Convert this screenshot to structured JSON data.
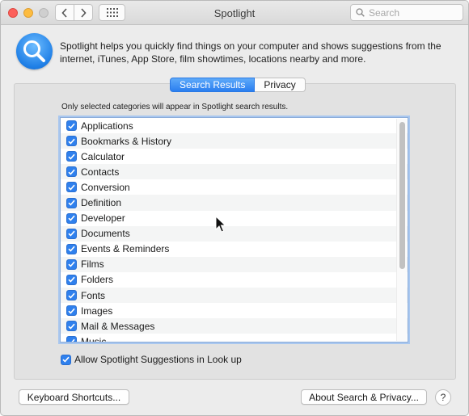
{
  "window": {
    "title": "Spotlight"
  },
  "toolbar": {
    "back_icon": "chevron-left-icon",
    "forward_icon": "chevron-right-icon",
    "show_all_icon": "grid-icon",
    "search": {
      "placeholder": "Search",
      "value": ""
    }
  },
  "header": {
    "icon": "spotlight-magnifier-icon",
    "description": "Spotlight helps you quickly find things on your computer and shows suggestions from the internet, iTunes, App Store, film showtimes, locations nearby and more."
  },
  "tabs": [
    {
      "label": "Search Results",
      "active": true
    },
    {
      "label": "Privacy",
      "active": false
    }
  ],
  "categories_note": "Only selected categories will appear in Spotlight search results.",
  "categories": [
    {
      "label": "Applications",
      "checked": true
    },
    {
      "label": "Bookmarks & History",
      "checked": true
    },
    {
      "label": "Calculator",
      "checked": true
    },
    {
      "label": "Contacts",
      "checked": true
    },
    {
      "label": "Conversion",
      "checked": true
    },
    {
      "label": "Definition",
      "checked": true
    },
    {
      "label": "Developer",
      "checked": true
    },
    {
      "label": "Documents",
      "checked": true
    },
    {
      "label": "Events & Reminders",
      "checked": true
    },
    {
      "label": "Films",
      "checked": true
    },
    {
      "label": "Folders",
      "checked": true
    },
    {
      "label": "Fonts",
      "checked": true
    },
    {
      "label": "Images",
      "checked": true
    },
    {
      "label": "Mail & Messages",
      "checked": true
    },
    {
      "label": "Music",
      "checked": true
    }
  ],
  "allow_suggestions": {
    "label": "Allow Spotlight Suggestions in Look up",
    "checked": true
  },
  "buttons": {
    "keyboard_shortcuts": "Keyboard Shortcuts...",
    "about_search_privacy": "About Search & Privacy...",
    "help": "?"
  },
  "colors": {
    "accent": "#2f80ed",
    "window_bg": "#ececec",
    "panel_bg": "#e2e2e2"
  }
}
